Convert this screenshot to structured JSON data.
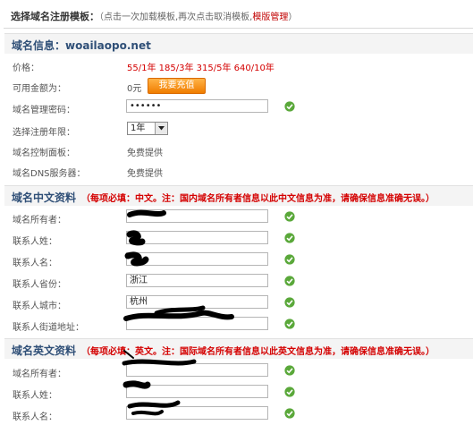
{
  "page": {
    "template_title": "选择域名注册模板：",
    "template_hint": "（点击一次加载模板,再次点击取消模板,",
    "template_link": "模版管理",
    "template_hint_end": "）"
  },
  "domain_info": {
    "title_prefix": "域名信息：",
    "domain": "woailaopo.net",
    "price_label": "价格：",
    "price_value": "55/1年  185/3年  315/5年  640/10年",
    "balance_label": "可用金额为：",
    "balance_value": "0元",
    "recharge_button": "我要充值",
    "password_label": "域名管理密码：",
    "password_value": "••••••",
    "years_label": "选择注册年限：",
    "years_value": "1年",
    "panel_label": "域名控制面板：",
    "panel_value": "免费提供",
    "dns_label": "域名DNS服务器：",
    "dns_value": "免费提供"
  },
  "cn_info": {
    "title": "域名中文资料",
    "note": "（每项必填：中文。注：国内域名所有者信息以此中文信息为准，请确保信息准确无误。）",
    "owner_label": "域名所有者：",
    "surname_label": "联系人姓：",
    "name_label": "联系人名：",
    "province_label": "联系人省份：",
    "province_value": "浙江",
    "city_label": "联系人城市：",
    "city_value": "杭州",
    "address_label": "联系人街道地址："
  },
  "en_info": {
    "title": "域名英文资料",
    "note": "（每项必填：英文。注：国际域名所有者信息以此英文信息为准，请确保信息准确无误。）",
    "owner_label": "域名所有者：",
    "surname_label": "联系人姓：",
    "name_label": "联系人名："
  },
  "colors": {
    "accent_red": "#d40000",
    "heading_blue": "#2f4f77",
    "check_green": "#5aa83a",
    "button_orange": "#f07d00"
  }
}
